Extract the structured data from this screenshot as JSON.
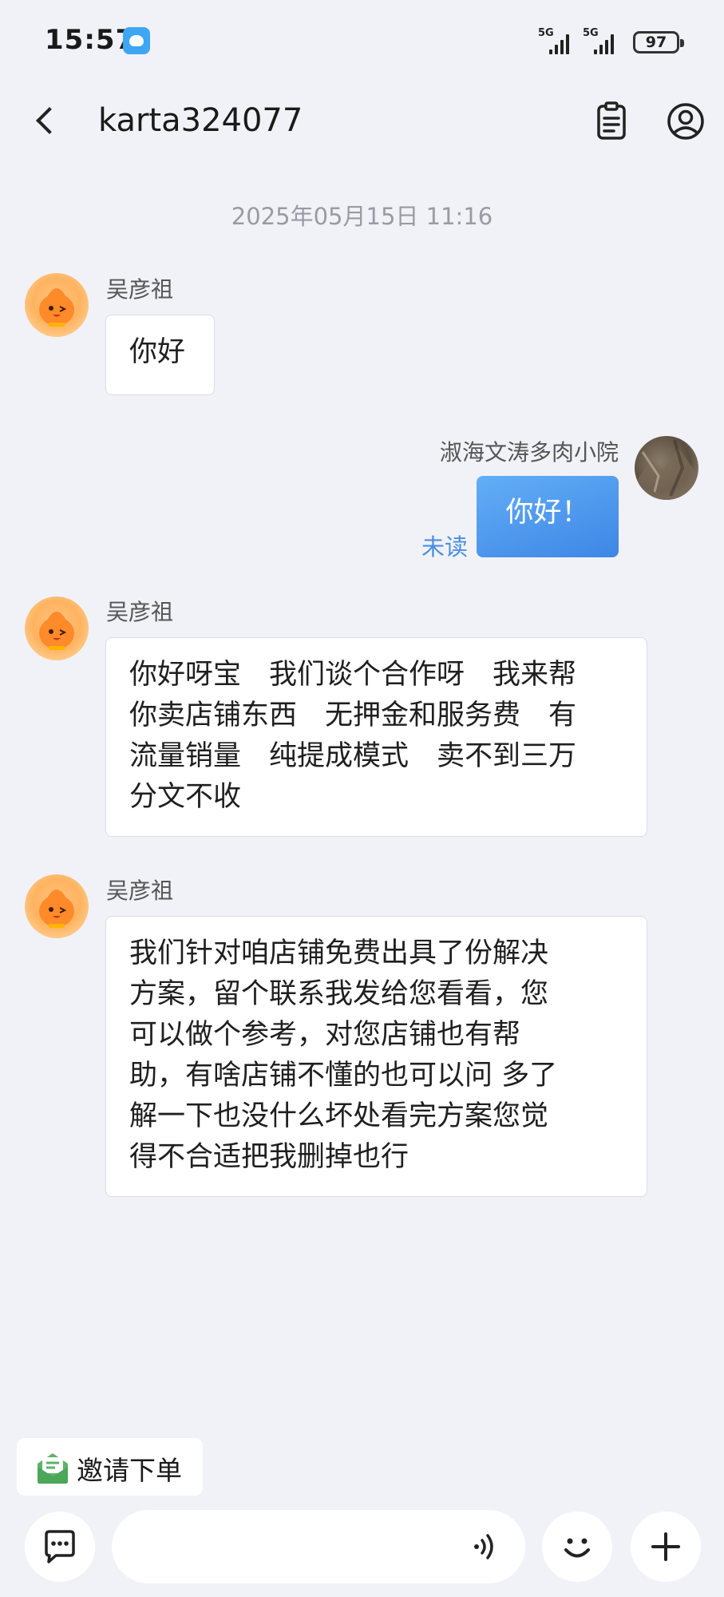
{
  "status_bar": {
    "time": "15:57",
    "signal1_label": "5G",
    "signal2_label": "5G",
    "battery": "97"
  },
  "header": {
    "title": "karta324077"
  },
  "chat": {
    "timestamp": "2025年05月15日 11:16",
    "messages": [
      {
        "sender": "吴彦祖",
        "direction": "incoming",
        "text": "你好"
      },
      {
        "sender": "淑海文涛多肉小院",
        "direction": "outgoing",
        "text": "你好！",
        "status": "未读"
      },
      {
        "sender": "吴彦祖",
        "direction": "incoming",
        "lines": [
          "你好呀宝　我们谈个合作呀　我来帮",
          "你卖店铺东西　无押金和服务费　有",
          "流量销量　纯提成模式　卖不到三万",
          "分文不收"
        ]
      },
      {
        "sender": "吴彦祖",
        "direction": "incoming",
        "lines": [
          "我们针对咱店铺免费出具了份解决",
          "方案，留个联系我发给您看看，您",
          "可以做个参考，对您店铺也有帮",
          "助，有啥店铺不懂的也可以问 多了",
          "解一下也没什么坏处看完方案您觉",
          "得不合适把我删掉也行"
        ]
      }
    ]
  },
  "bottom_bar": {
    "invite_label": "邀请下单"
  },
  "colors": {
    "background": "#f1f2f7",
    "outgoing_bubble": "#4a8fe0",
    "unread_text": "#4a8fe0"
  },
  "icons": [
    "back-icon",
    "notes-icon",
    "profile-icon",
    "chat-icon",
    "voice-icon",
    "emoji-icon",
    "plus-icon",
    "invite-icon"
  ]
}
